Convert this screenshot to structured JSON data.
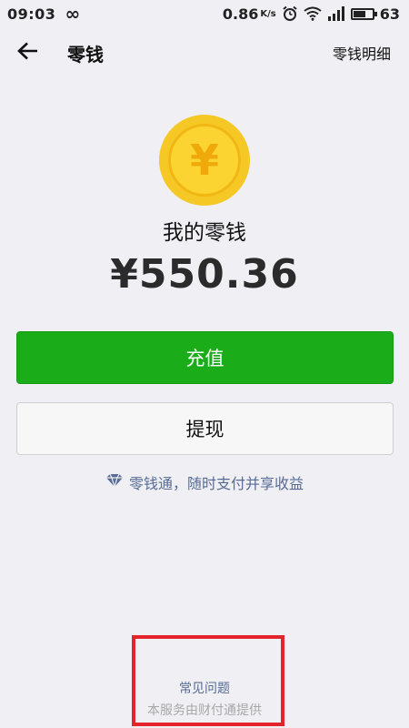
{
  "status_bar": {
    "time": "09:03",
    "infinity": "∞",
    "speed": "0.86",
    "speed_unit": "K/s",
    "battery_pct": "63"
  },
  "nav": {
    "title": "零钱",
    "right_action": "零钱明细"
  },
  "coin": {
    "symbol": "¥"
  },
  "balance": {
    "label": "我的零钱",
    "amount": "¥550.36"
  },
  "buttons": {
    "recharge": "充值",
    "withdraw": "提现"
  },
  "promo": {
    "text": "零钱通，随时支付并享收益"
  },
  "footer": {
    "faq": "常见问题",
    "provider": "本服务由财付通提供"
  },
  "colors": {
    "background": "#efeff4",
    "primary_green": "#1aad19",
    "link_blue": "#576b95",
    "coin_yellow": "#f6c826",
    "highlight_red": "#e5232a"
  }
}
